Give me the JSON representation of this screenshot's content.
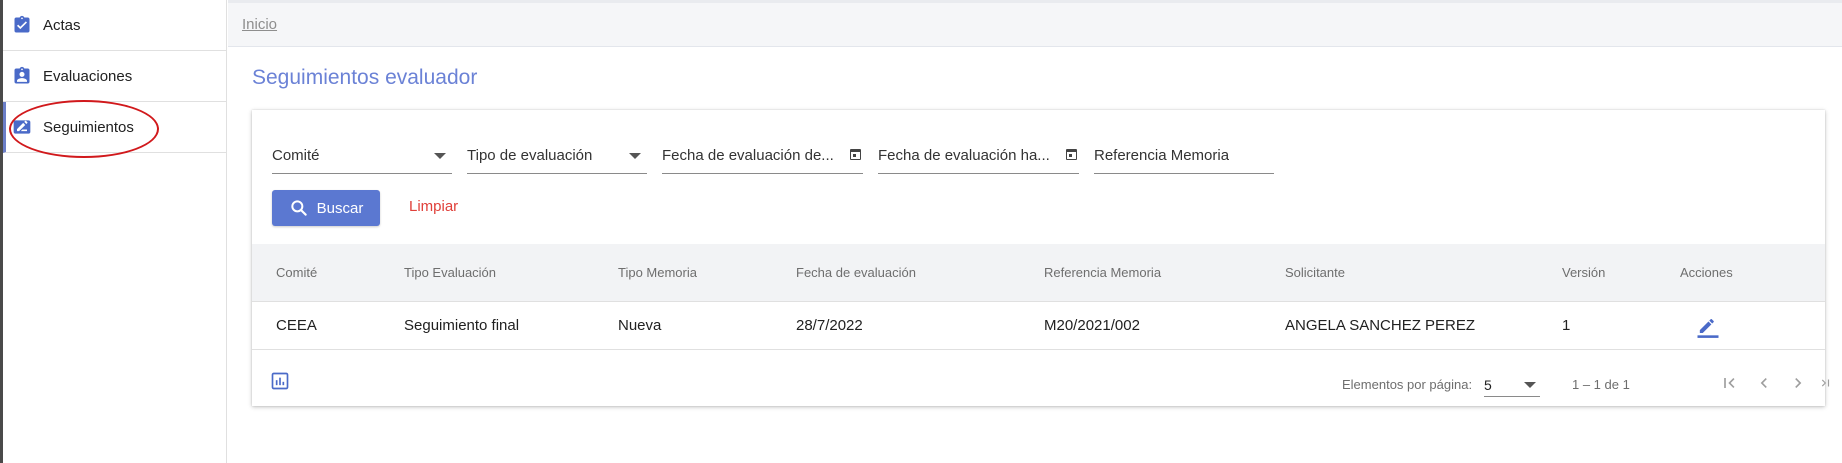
{
  "sidebar": {
    "items": [
      {
        "label": "Actas",
        "icon": "clipboard-check-icon"
      },
      {
        "label": "Evaluaciones",
        "icon": "clipboard-account-icon"
      },
      {
        "label": "Seguimientos",
        "icon": "pencil-box-icon"
      }
    ],
    "active": "Seguimientos"
  },
  "breadcrumb": "Inicio",
  "page_title": "Seguimientos evaluador",
  "filters": {
    "comite": "Comité",
    "tipo_evaluacion": "Tipo de evaluación",
    "fecha_desde": "Fecha de evaluación de...",
    "fecha_hasta": "Fecha de evaluación ha...",
    "referencia_memoria": "Referencia Memoria"
  },
  "actions": {
    "buscar": "Buscar",
    "limpiar": "Limpiar"
  },
  "table": {
    "columns": [
      "Comité",
      "Tipo Evaluación",
      "Tipo Memoria",
      "Fecha de evaluación",
      "Referencia Memoria",
      "Solicitante",
      "Versión",
      "Acciones"
    ],
    "rows": [
      [
        "CEEA",
        "Seguimiento final",
        "Nueva",
        "28/7/2022",
        "M20/2021/002",
        "ANGELA SANCHEZ PEREZ",
        "1"
      ]
    ]
  },
  "paginator": {
    "items_per_page_label": "Elementos por página:",
    "page_size": "5",
    "range": "1 – 1 de 1"
  },
  "colors": {
    "accent": "#5b78d1",
    "title": "#6b82d6",
    "danger": "#e0403a",
    "highlight": "#d1191c"
  }
}
